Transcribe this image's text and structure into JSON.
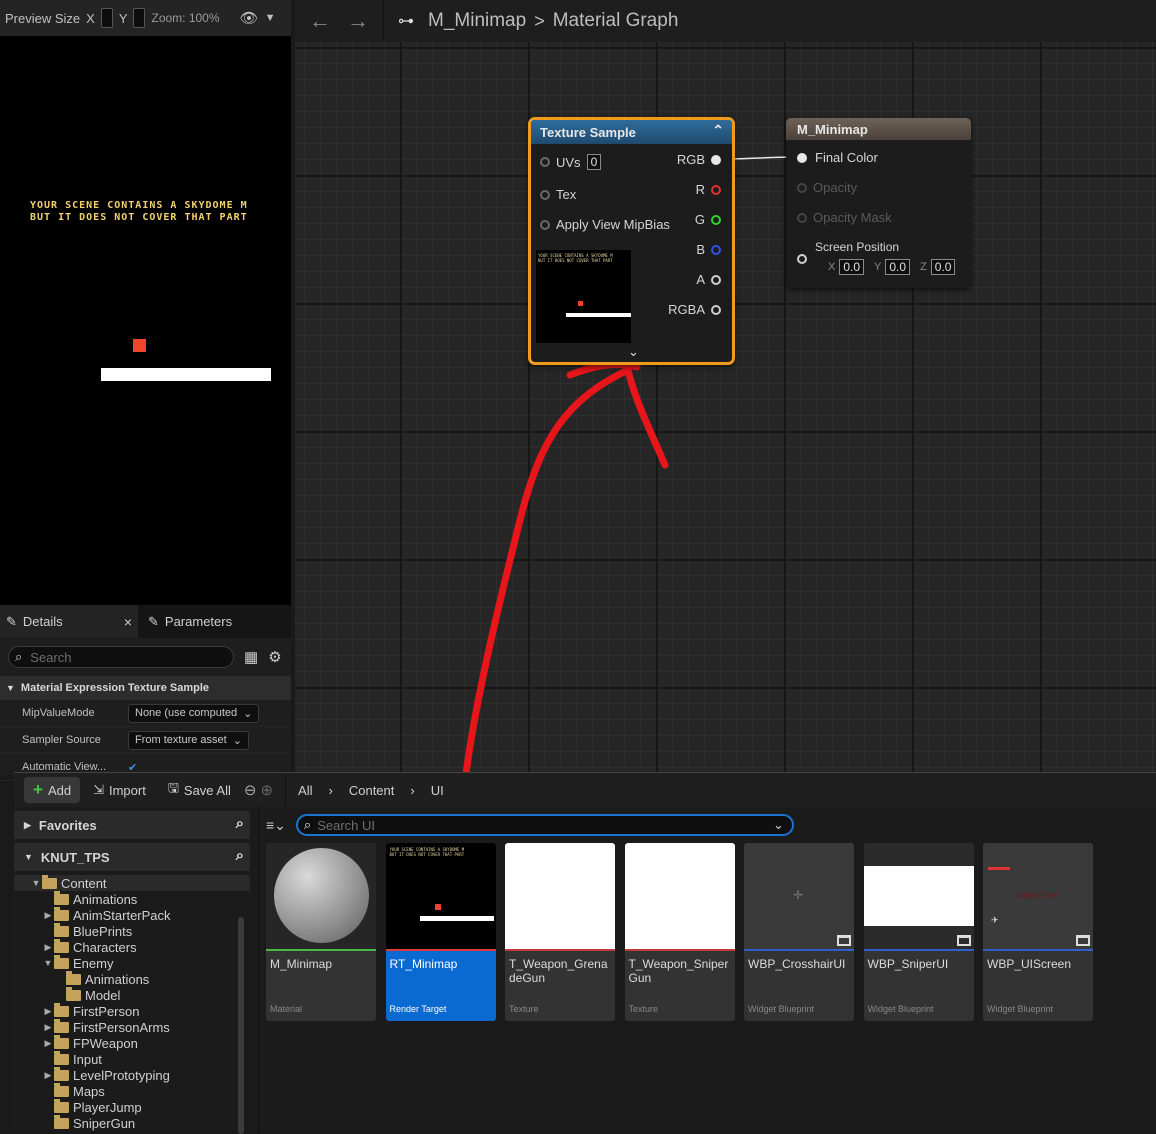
{
  "preview": {
    "label": "Preview Size",
    "x_label": "X",
    "y_label": "Y",
    "zoom": "Zoom: 100%",
    "message_line1": "YOUR SCENE CONTAINS A SKYDOME M",
    "message_line2": "BUT IT DOES NOT COVER THAT PART"
  },
  "graph": {
    "breadcrumb_asset": "M_Minimap",
    "breadcrumb_sep": ">",
    "breadcrumb_graph": "Material Graph",
    "texture_node": {
      "title": "Texture Sample",
      "inputs": [
        {
          "label": "UVs",
          "value": "0"
        },
        {
          "label": "Tex"
        },
        {
          "label": "Apply View MipBias"
        }
      ],
      "outputs": [
        {
          "label": "RGB",
          "color": "#ffffff"
        },
        {
          "label": "R",
          "color": "#e03030"
        },
        {
          "label": "G",
          "color": "#30d030"
        },
        {
          "label": "B",
          "color": "#3050e0"
        },
        {
          "label": "A",
          "color": "#cccccc"
        },
        {
          "label": "RGBA",
          "color": "#cccccc"
        }
      ]
    },
    "result_node": {
      "title": "M_Minimap",
      "pins": [
        {
          "label": "Final Color",
          "enabled": true
        },
        {
          "label": "Opacity",
          "enabled": false
        },
        {
          "label": "Opacity Mask",
          "enabled": false
        },
        {
          "label": "Screen Position",
          "enabled": true
        }
      ],
      "coords": {
        "x_label": "X",
        "x": "0.0",
        "y_label": "Y",
        "y": "0.0",
        "z_label": "Z",
        "z": "0.0"
      }
    }
  },
  "details": {
    "tab_details": "Details",
    "tab_parameters": "Parameters",
    "search_placeholder": "Search",
    "section_title": "Material Expression Texture Sample",
    "props": [
      {
        "label": "MipValueMode",
        "value": "None (use computed"
      },
      {
        "label": "Sampler Source",
        "value": "From texture asset"
      },
      {
        "label": "Automatic View..."
      }
    ]
  },
  "content_browser": {
    "add_label": "Add",
    "import_label": "Import",
    "save_all_label": "Save All",
    "path": [
      "All",
      "Content",
      "UI"
    ],
    "favorites": "Favorites",
    "project": "KNUT_TPS",
    "search_placeholder": "Search UI",
    "tree": [
      {
        "label": "Content",
        "indent": 1,
        "expanded": true,
        "selected": true
      },
      {
        "label": "Animations",
        "indent": 2
      },
      {
        "label": "AnimStarterPack",
        "indent": 2,
        "has_children": true
      },
      {
        "label": "BluePrints",
        "indent": 2
      },
      {
        "label": "Characters",
        "indent": 2,
        "has_children": true
      },
      {
        "label": "Enemy",
        "indent": 2,
        "expanded": true
      },
      {
        "label": "Animations",
        "indent": 3
      },
      {
        "label": "Model",
        "indent": 3
      },
      {
        "label": "FirstPerson",
        "indent": 2,
        "has_children": true
      },
      {
        "label": "FirstPersonArms",
        "indent": 2,
        "has_children": true
      },
      {
        "label": "FPWeapon",
        "indent": 2,
        "has_children": true
      },
      {
        "label": "Input",
        "indent": 2
      },
      {
        "label": "LevelPrototyping",
        "indent": 2,
        "has_children": true
      },
      {
        "label": "Maps",
        "indent": 2
      },
      {
        "label": "PlayerJump",
        "indent": 2
      },
      {
        "label": "SniperGun",
        "indent": 2
      }
    ],
    "assets": [
      {
        "name": "M_Minimap",
        "type": "Material",
        "strip": "#48b748"
      },
      {
        "name": "RT_Minimap",
        "type": "Render Target",
        "strip": "#e03a3a",
        "selected": true
      },
      {
        "name": "T_Weapon_GrenadeGun",
        "type": "Texture",
        "strip": "#c23a3a"
      },
      {
        "name": "T_Weapon_SniperGun",
        "type": "Texture",
        "strip": "#c23a3a"
      },
      {
        "name": "WBP_CrosshairUI",
        "type": "Widget Blueprint",
        "strip": "#2f5fc9"
      },
      {
        "name": "WBP_SniperUI",
        "type": "Widget Blueprint",
        "strip": "#2f5fc9"
      },
      {
        "name": "WBP_UIScreen",
        "type": "Widget Blueprint",
        "strip": "#2f5fc9"
      }
    ],
    "uiscreen_thumb_text": "Game Over"
  }
}
